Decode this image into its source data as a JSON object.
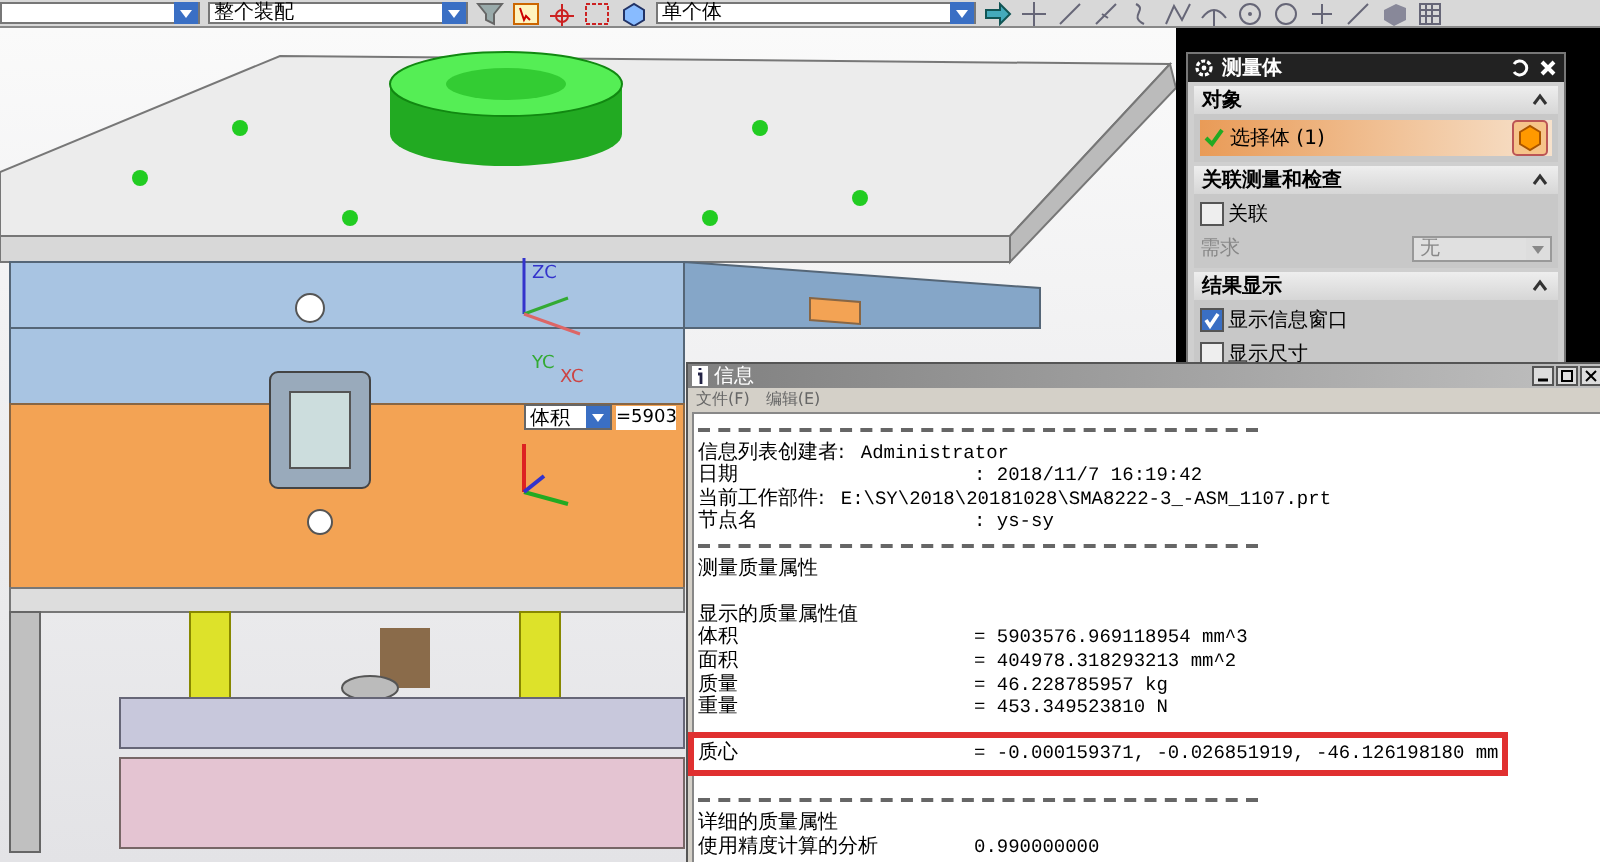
{
  "toolbar": {
    "dropdowns": [
      {
        "value": "整个装配"
      },
      {
        "value": "单个体"
      }
    ]
  },
  "viewport": {
    "axis_labels": [
      "ZC",
      "YC",
      "XC"
    ],
    "measure": {
      "type": "体积",
      "value": "=5903"
    }
  },
  "measure_panel": {
    "title": "测量体",
    "sections": [
      {
        "title": "对象",
        "expanded": true,
        "rows": [
          {
            "kind": "selection",
            "label": "选择体 (1)",
            "done": true
          }
        ]
      },
      {
        "title": "关联测量和检查",
        "expanded": true,
        "rows": [
          {
            "kind": "checkbox",
            "label": "关联",
            "checked": false
          },
          {
            "kind": "dropdown",
            "label": "需求",
            "value": "无",
            "disabled": true
          }
        ]
      },
      {
        "title": "结果显示",
        "expanded": true,
        "rows": [
          {
            "kind": "checkbox",
            "label": "显示信息窗口",
            "checked": true
          },
          {
            "kind": "checkbox",
            "label": "显示尺寸",
            "checked": false
          }
        ]
      }
    ]
  },
  "info_window": {
    "title": "信息",
    "menu": [
      "文件(F)",
      "编辑(E)"
    ],
    "lines": [
      {
        "kind": "rule"
      },
      {
        "kind": "inline",
        "label": "信息列表创建者:",
        "value": "Administrator"
      },
      {
        "kind": "pair",
        "label": "日期",
        "value": ":  2018/11/7 16:19:42"
      },
      {
        "kind": "inline",
        "label": "当前工作部件:",
        "value": "E:\\SY\\2018\\20181028\\SMA8222-3_-ASM_1107.prt"
      },
      {
        "kind": "pair",
        "label": "节点名",
        "value": ":  ys-sy"
      },
      {
        "kind": "rule"
      },
      {
        "kind": "text",
        "label": "测量质量属性"
      },
      {
        "kind": "blank"
      },
      {
        "kind": "text",
        "label": "显示的质量属性值"
      },
      {
        "kind": "pair",
        "label": "体积",
        "value": "=  5903576.969118954 mm^3"
      },
      {
        "kind": "pair",
        "label": "面积",
        "value": "=  404978.318293213 mm^2"
      },
      {
        "kind": "pair",
        "label": "质量",
        "value": "=     46.228785957 kg"
      },
      {
        "kind": "pair",
        "label": "重量",
        "value": "=    453.349523810 N"
      },
      {
        "kind": "blank"
      },
      {
        "kind": "pair",
        "label": "质心",
        "value": "=   -0.000159371,   -0.026851919,   -46.126198180 mm",
        "highlighted": true
      },
      {
        "kind": "blank"
      },
      {
        "kind": "rule"
      },
      {
        "kind": "text",
        "label": "详细的质量属性"
      },
      {
        "kind": "pair",
        "label": "使用精度计算的分析",
        "value": "0.990000000"
      }
    ]
  }
}
